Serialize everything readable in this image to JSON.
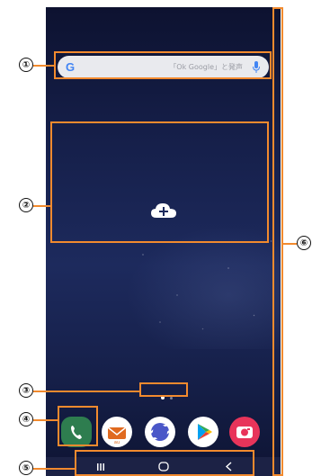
{
  "search": {
    "logo": "G",
    "hint": "「Ok Google」と発声",
    "icons": [
      "google-logo",
      "mic-icon"
    ]
  },
  "widget_area": {
    "icon": "cloud-plus-icon"
  },
  "page_indicator": {
    "pages": 2,
    "current": 1
  },
  "dock": {
    "apps": [
      "phone-app",
      "au-mail-app",
      "internet-app",
      "play-store-app",
      "camera-app"
    ]
  },
  "nav": {
    "buttons": [
      "recent-apps",
      "home",
      "back"
    ]
  },
  "callouts": {
    "c1": "①",
    "c2": "②",
    "c3": "③",
    "c4": "④",
    "c5": "⑤",
    "c6": "⑥"
  },
  "colors": {
    "annotation": "#f28a2e",
    "wallpaper": "#1a2454",
    "phone_app": "#2e7d4f",
    "camera_app": "#e8345a"
  }
}
